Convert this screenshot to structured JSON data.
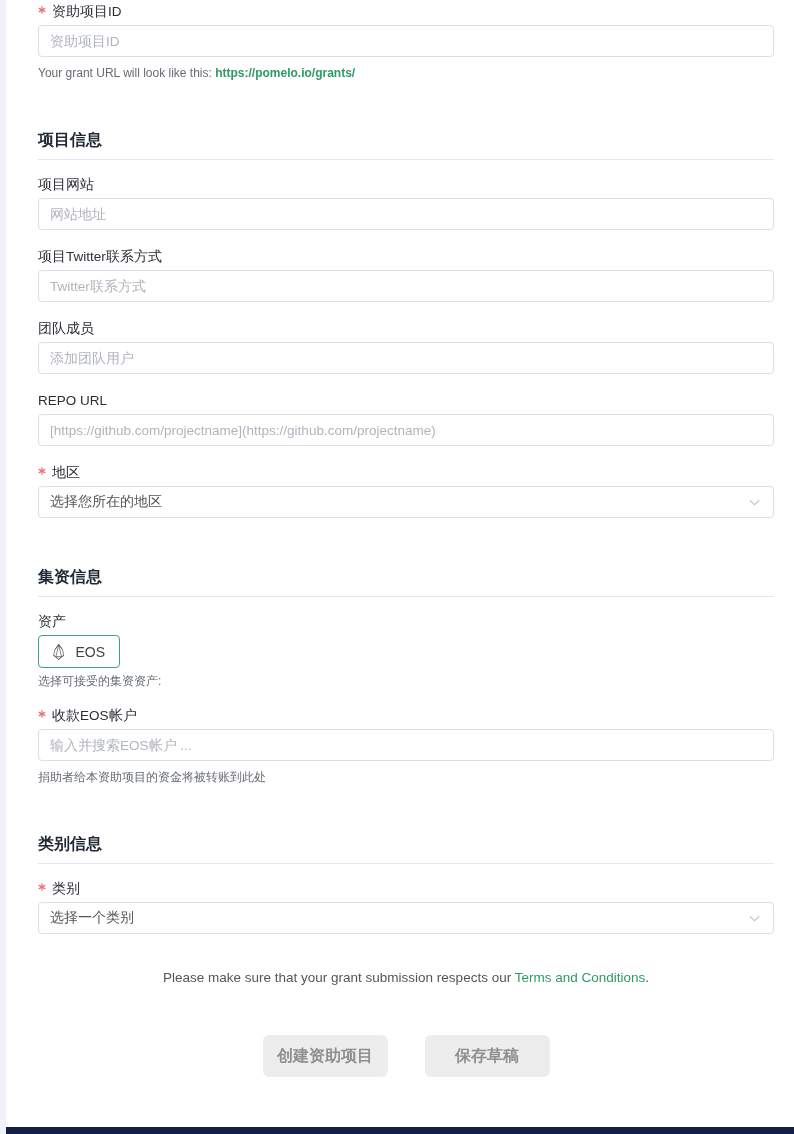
{
  "form": [
    {
      "kind": "input",
      "label": "资助项目ID",
      "required": true,
      "placeholder": "资助项目ID",
      "hint": "Your grant URL will look like this:",
      "hint_link": "https://pomelo.io/grants/"
    },
    {
      "kind": "heading",
      "title": "项目信息"
    },
    {
      "kind": "input",
      "label": "项目网站",
      "required": false,
      "placeholder": "网站地址"
    },
    {
      "kind": "input",
      "label": "项目Twitter联系方式",
      "required": false,
      "placeholder": "Twitter联系方式"
    },
    {
      "kind": "input",
      "label": "团队成员",
      "required": false,
      "placeholder": "添加团队用户"
    },
    {
      "kind": "input",
      "label": "REPO URL",
      "required": false,
      "placeholder": "[https://github.com/projectname](https://github.com/projectname)"
    },
    {
      "kind": "select",
      "label": "地区",
      "required": true,
      "value": "选择您所在的地区"
    },
    {
      "kind": "heading",
      "title": "集资信息"
    },
    {
      "kind": "assets",
      "label": "资产",
      "required": false,
      "options": [
        {
          "label": "EOS",
          "selected": true
        }
      ],
      "hint": "选择可接受的集资资产:"
    },
    {
      "kind": "input",
      "label": "收款EOS帐户",
      "required": true,
      "placeholder": "输入并搜索EOS帐户 ...",
      "hint": "捐助者给本资助项目的资金将被转账到此处"
    },
    {
      "kind": "heading",
      "title": "类别信息"
    },
    {
      "kind": "select",
      "label": "类别",
      "required": true,
      "value": "选择一个类别"
    }
  ],
  "terms": {
    "text": "Please make sure that your grant submission respects our",
    "link": "Terms and Conditions",
    "end": "."
  },
  "buttons": [
    {
      "label": "创建资助项目",
      "disabled": true
    },
    {
      "label": "保存草稿",
      "disabled": true
    }
  ]
}
